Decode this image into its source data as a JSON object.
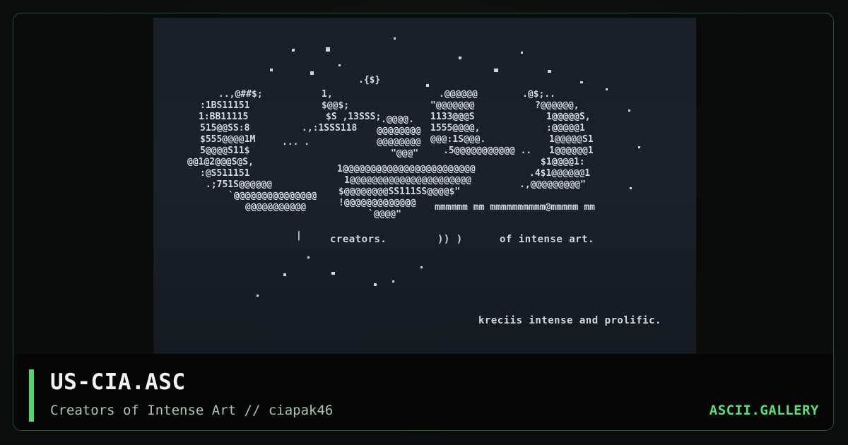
{
  "artwork": {
    "line1_left": "creators.",
    "line1_mid": "))   )",
    "line1_right": "of intense art.",
    "line2": "kreciis intense and prolific.",
    "logo_text": "mmmmmm mm mmmmmmmmmm@mmmmm mm"
  },
  "footer": {
    "title": "US-CIA.ASC",
    "subtitle": "Creators of Intense Art // ciapak46",
    "brand": "ASCII.GALLERY"
  },
  "colors": {
    "accent": "#4ed86c",
    "brand": "#56e07a",
    "border": "#1f5a2e",
    "art_background": "#1a2029"
  }
}
